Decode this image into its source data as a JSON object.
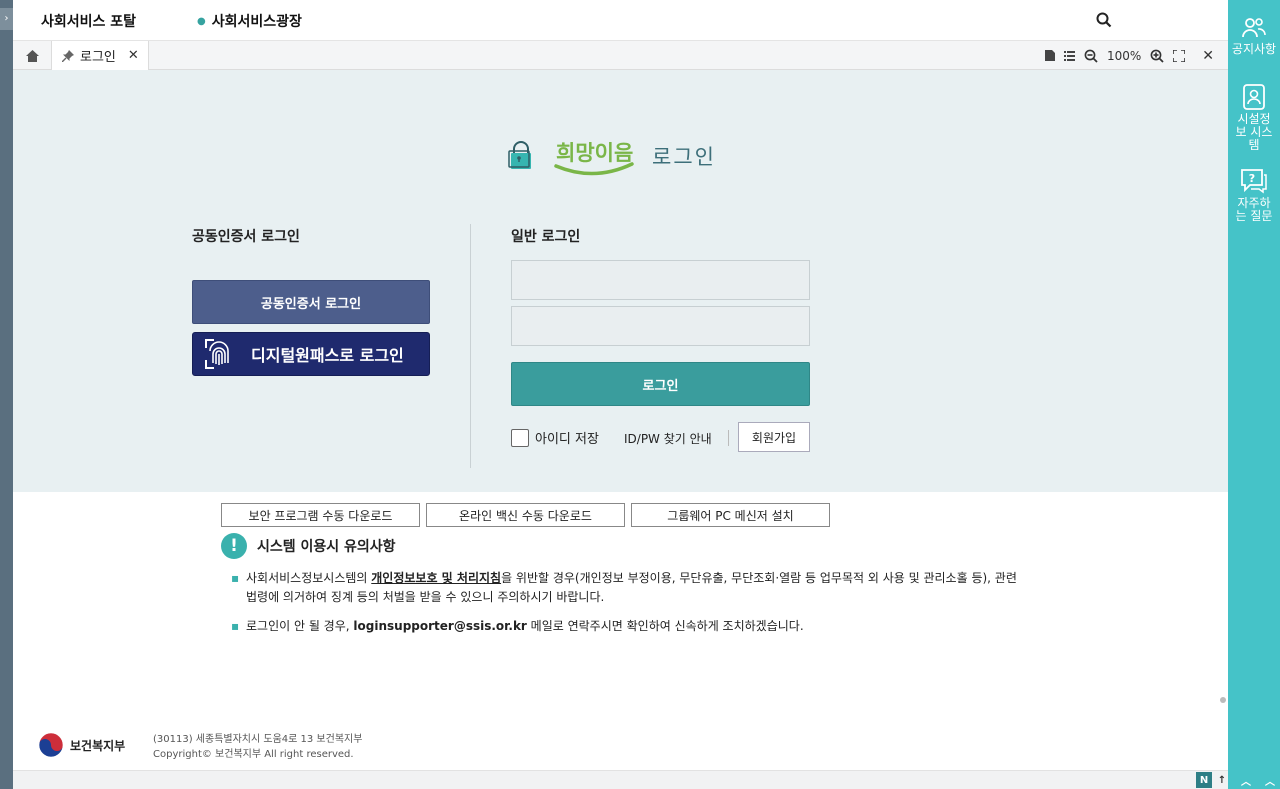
{
  "header": {
    "portal_label": "사회서비스 포탈",
    "plaza_label": "사회서비스광장"
  },
  "tabs": {
    "home_icon": "home-icon",
    "login_tab_label": "로그인",
    "zoom_level": "100%"
  },
  "logo": {
    "brand": "희망이음",
    "title": "로그인"
  },
  "cert_login": {
    "title": "공동인증서 로그인",
    "cert_button": "공동인증서 로그인",
    "digital_button": "디지털원패스로 로그인"
  },
  "general_login": {
    "title": "일반 로그인",
    "id_placeholder": "",
    "pw_placeholder": "",
    "login_button": "로그인",
    "save_id": "아이디 저장",
    "find_idpw": "ID/PW 찾기 안내",
    "join": "회원가입"
  },
  "downloads": [
    "보안 프로그램 수동 다운로드",
    "온라인 백신 수동 다운로드",
    "그룹웨어 PC 메신저 설치"
  ],
  "notice": {
    "title": "시스템 이용시 유의사항",
    "item1_pre": "사회서비스정보시스템의 ",
    "item1_link": "개인정보보호 및 처리지침",
    "item1_post": "을 위반할 경우(개인정보 부정이용, 무단유출, 무단조회·열람 등 업무목적 외 사용 및 관리소홀 등), 관련 법령에 의거하여 징계 등의 처벌을 받을 수 있으니 주의하시기 바랍니다.",
    "item2_pre": "로그인이 안 될 경우, ",
    "item2_email": "loginsupporter@ssis.or.kr",
    "item2_post": " 메일로 연락주시면 확인하여 신속하게 조치하겠습니다."
  },
  "footer": {
    "ministry": "보건복지부",
    "address": "(30113) 세종특별자치시 도움4로 13 보건복지부",
    "copyright": "Copyright© 보건복지부 All right reserved."
  },
  "sidebar": {
    "items": [
      {
        "label": "공지사항",
        "icon": "people-icon"
      },
      {
        "label": "시설정보 시스템",
        "icon": "profile-card-icon"
      },
      {
        "label": "자주하는 질문",
        "icon": "question-chat-icon"
      }
    ]
  },
  "colors": {
    "teal": "#3a9d9d",
    "sidebar": "#45c3c8",
    "cert_button": "#4d5e8c",
    "digital_button": "#1f2a6e"
  }
}
